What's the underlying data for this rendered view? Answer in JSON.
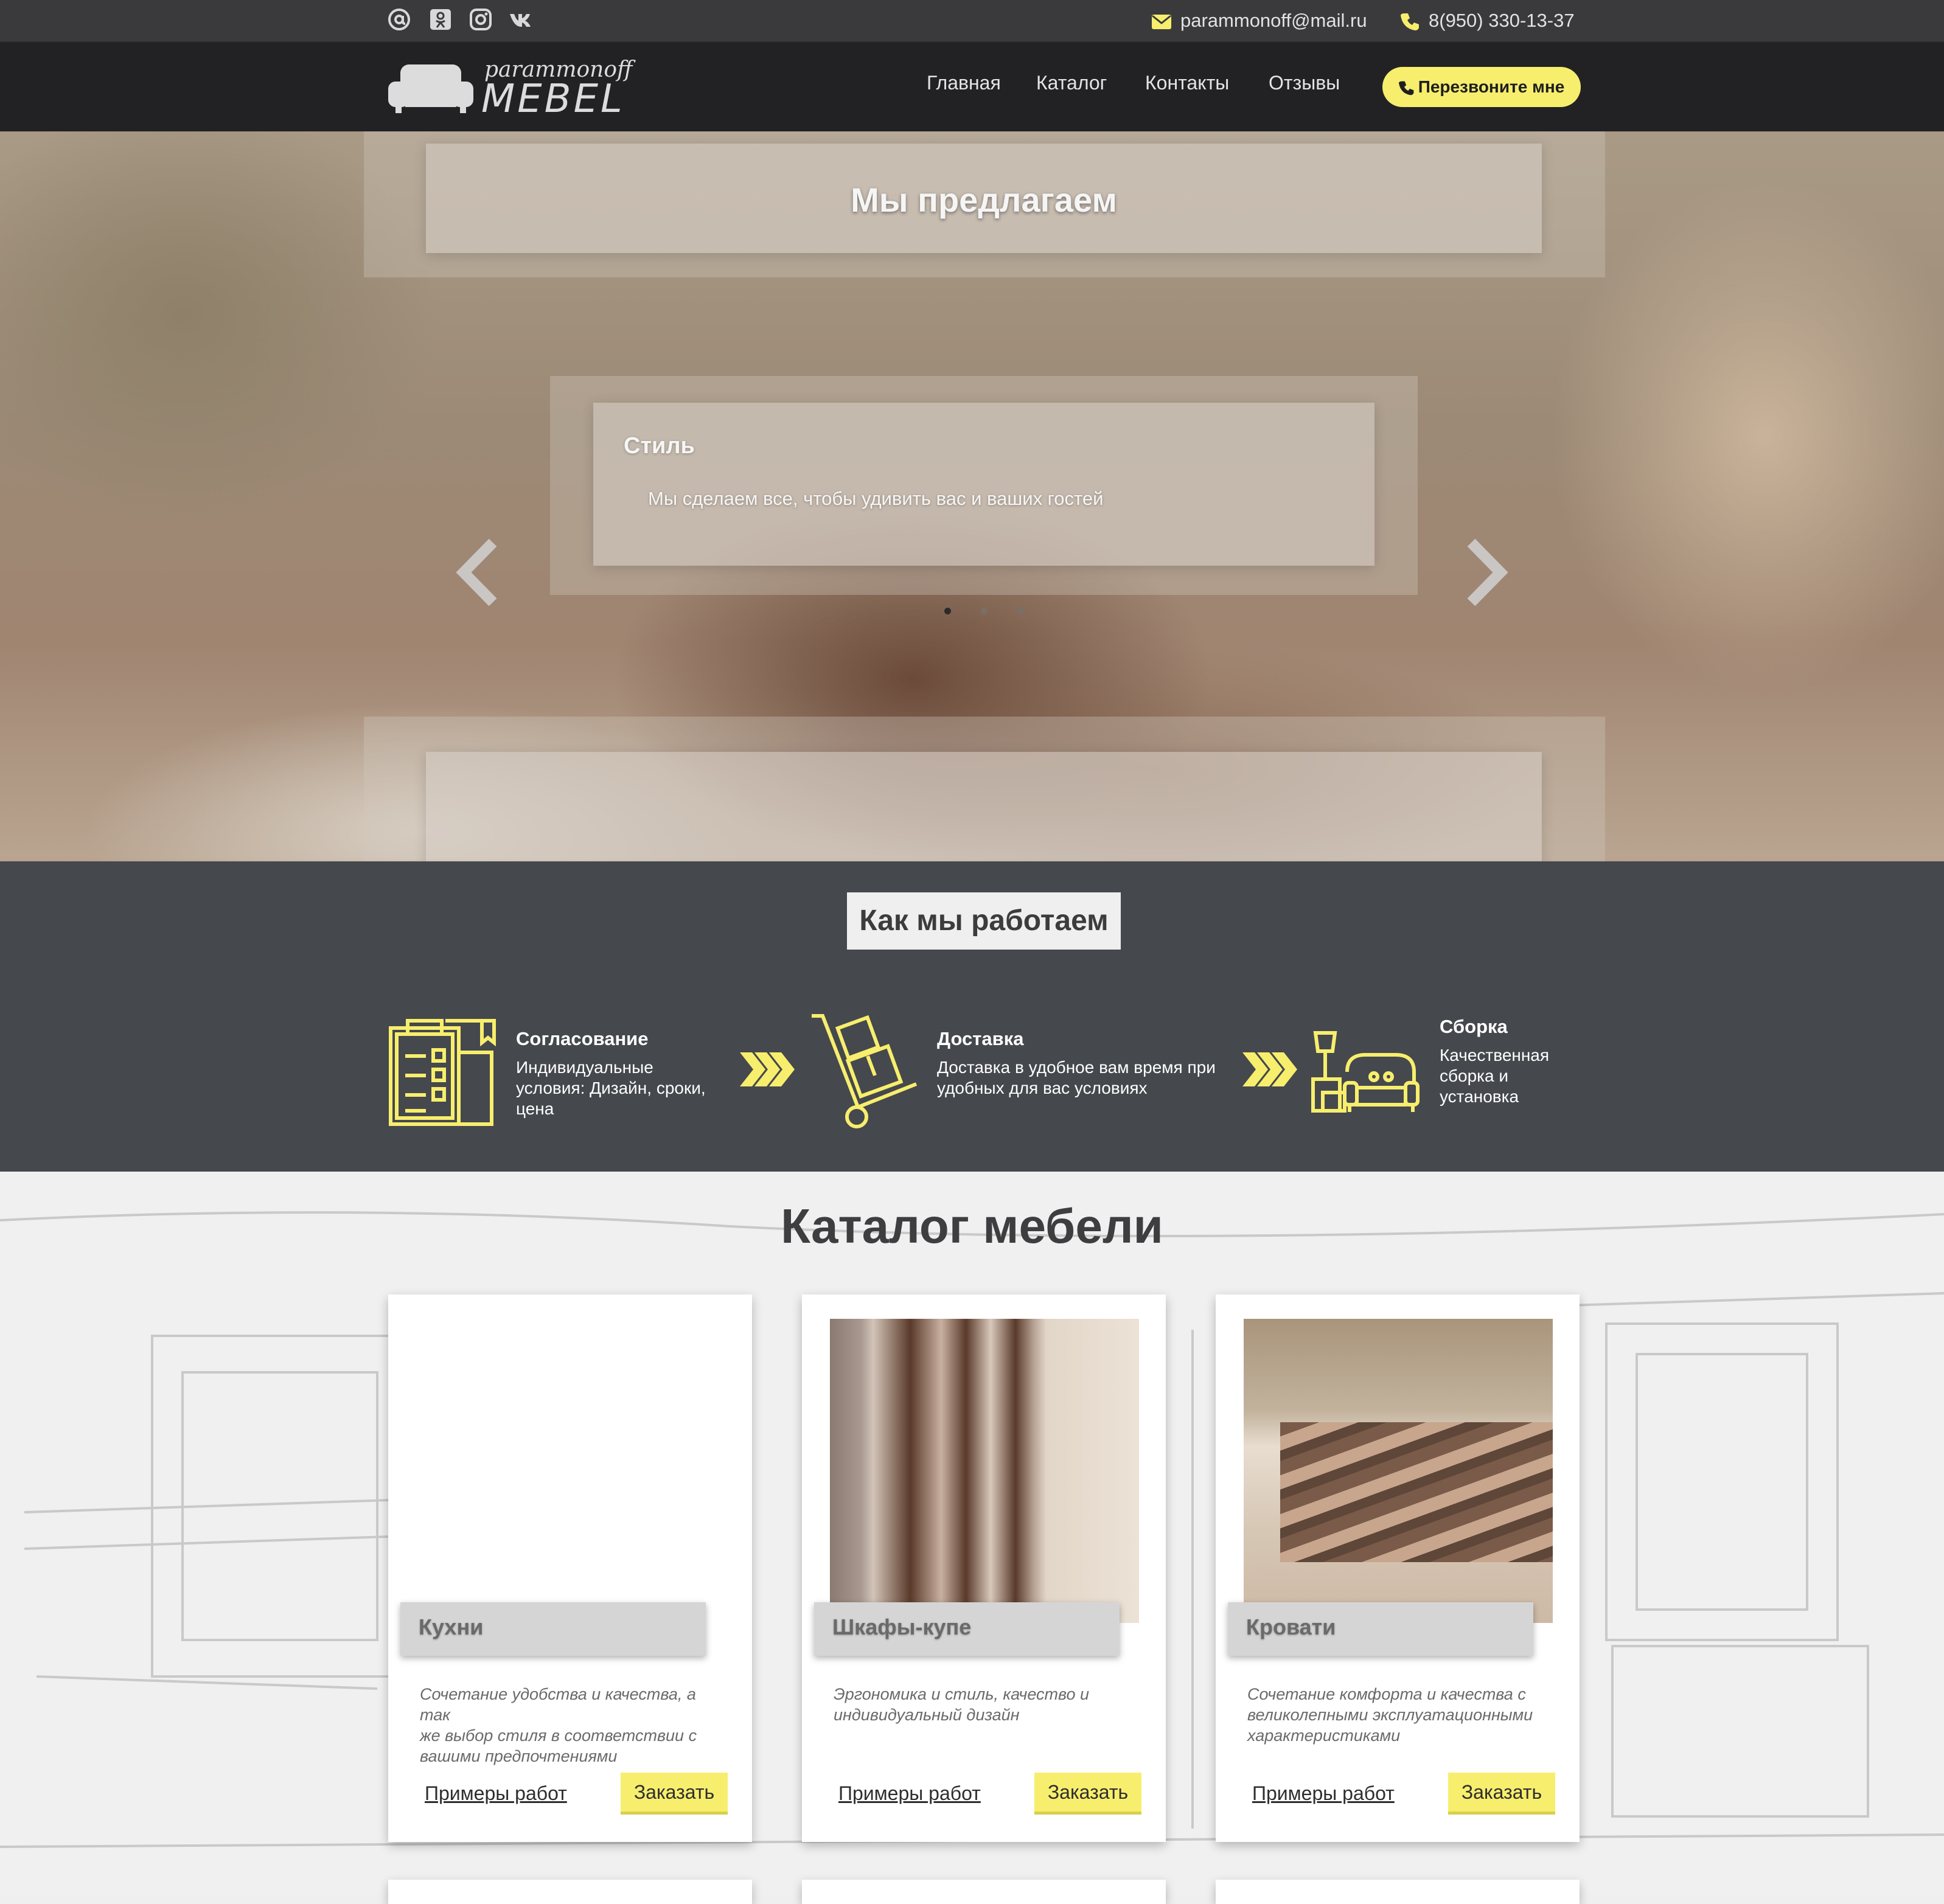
{
  "topbar": {
    "social": [
      {
        "icon": "at-icon"
      },
      {
        "icon": "odnoklassniki-icon"
      },
      {
        "icon": "instagram-icon"
      },
      {
        "icon": "vk-icon"
      }
    ],
    "email": "parammonoff@mail.ru",
    "phone": "8(950) 330-13-37"
  },
  "logo": {
    "line1": "parammonoff",
    "line2": "MEBEL"
  },
  "nav": {
    "items": [
      "Главная",
      "Каталог",
      "Контакты",
      "Отзывы"
    ],
    "call_button": "Перезвоните мне"
  },
  "hero": {
    "title": "Мы предлагаем",
    "slide": {
      "title": "Стиль",
      "text": "Мы сделаем все, чтобы удивить вас и ваших гостей"
    },
    "slide_count": 3,
    "active_slide": 1
  },
  "how": {
    "title": "Как мы работаем",
    "steps": [
      {
        "title": "Согласование",
        "text": [
          "Индивидуальные",
          "условия: Дизайн, сроки,",
          "цена"
        ]
      },
      {
        "title": "Доставка",
        "text": [
          "Доставка в удобное вам время при",
          "удобных для вас условиях"
        ]
      },
      {
        "title": "Сборка",
        "text": [
          "Качественная",
          "сборка и",
          "установка"
        ]
      }
    ]
  },
  "catalog": {
    "title": "Каталог мебели",
    "cards": [
      {
        "name": "Кухни",
        "desc": [
          "Сочетание удобства и качества, а так",
          "же выбор стиля в соответствии с",
          "вашими предпочтениями"
        ],
        "link": "Примеры работ",
        "button": "Заказать"
      },
      {
        "name": "Шкафы-купе",
        "desc": [
          "Эргономика и стиль, качество и",
          "индивидуальный дизайн"
        ],
        "link": "Примеры работ",
        "button": "Заказать"
      },
      {
        "name": "Кровати",
        "desc": [
          "Сочетание комфорта и качества с",
          "великолепными эксплуатационными",
          "характеристиками"
        ],
        "link": "Примеры работ",
        "button": "Заказать"
      }
    ]
  },
  "colors": {
    "accent": "#f7ee6d",
    "dark": "#222225",
    "panel": "#45484d"
  }
}
